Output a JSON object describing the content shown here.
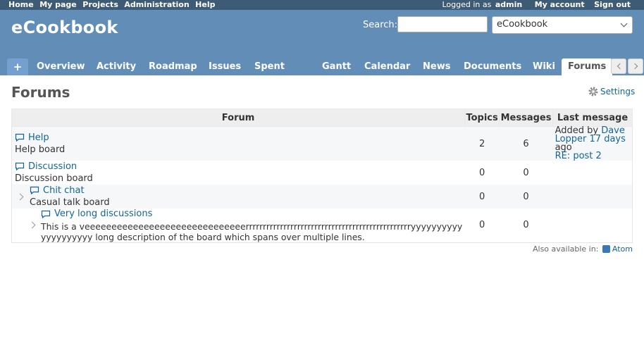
{
  "top_menu": {
    "left": [
      "Home",
      "My page",
      "Projects",
      "Administration",
      "Help"
    ],
    "logged_in_label": "Logged in as",
    "user": "admin",
    "my_account": "My account",
    "sign_out": "Sign out"
  },
  "header": {
    "title": "eCookbook",
    "search_label": "Search:",
    "search_value": "",
    "project_select": "eCookbook"
  },
  "tabs": {
    "new_label": "+",
    "items": [
      "Overview",
      "Activity",
      "Roadmap",
      "Issues",
      "Spent time",
      "Gantt",
      "Calendar",
      "News",
      "Documents",
      "Wiki",
      "Forums"
    ],
    "selected": "Forums"
  },
  "page": {
    "title": "Forums",
    "settings_label": "Settings"
  },
  "table": {
    "headers": [
      "Forum",
      "Topics",
      "Messages",
      "Last message"
    ],
    "rows": [
      {
        "name": "Help",
        "description": "Help board",
        "topics": "2",
        "messages": "6",
        "last_added_by": "Added by",
        "last_author": "Dave Lopper",
        "last_age": "17 days",
        "last_ago": "ago",
        "last_subject": "RE: post 2"
      },
      {
        "name": "Discussion",
        "description": "Discussion board",
        "topics": "0",
        "messages": "0"
      },
      {
        "name": "Chit chat",
        "description": "Casual talk board",
        "topics": "0",
        "messages": "0"
      },
      {
        "name": "Very long discussions",
        "description": "This is a veeeeeeeeeeeeeeeeeeeeeeeeeeeeeerrrrrrrrrrrrrrrrrrrrrrrrrrrrrrrrrrrrrrrrrrrrrrrryyyyyyyyyyyyyyyyyyyy long description of the board which spans over multiple lines.",
        "topics": "0",
        "messages": "0"
      }
    ]
  },
  "footer": {
    "also_available": "Also available in:",
    "atom": "Atom"
  }
}
